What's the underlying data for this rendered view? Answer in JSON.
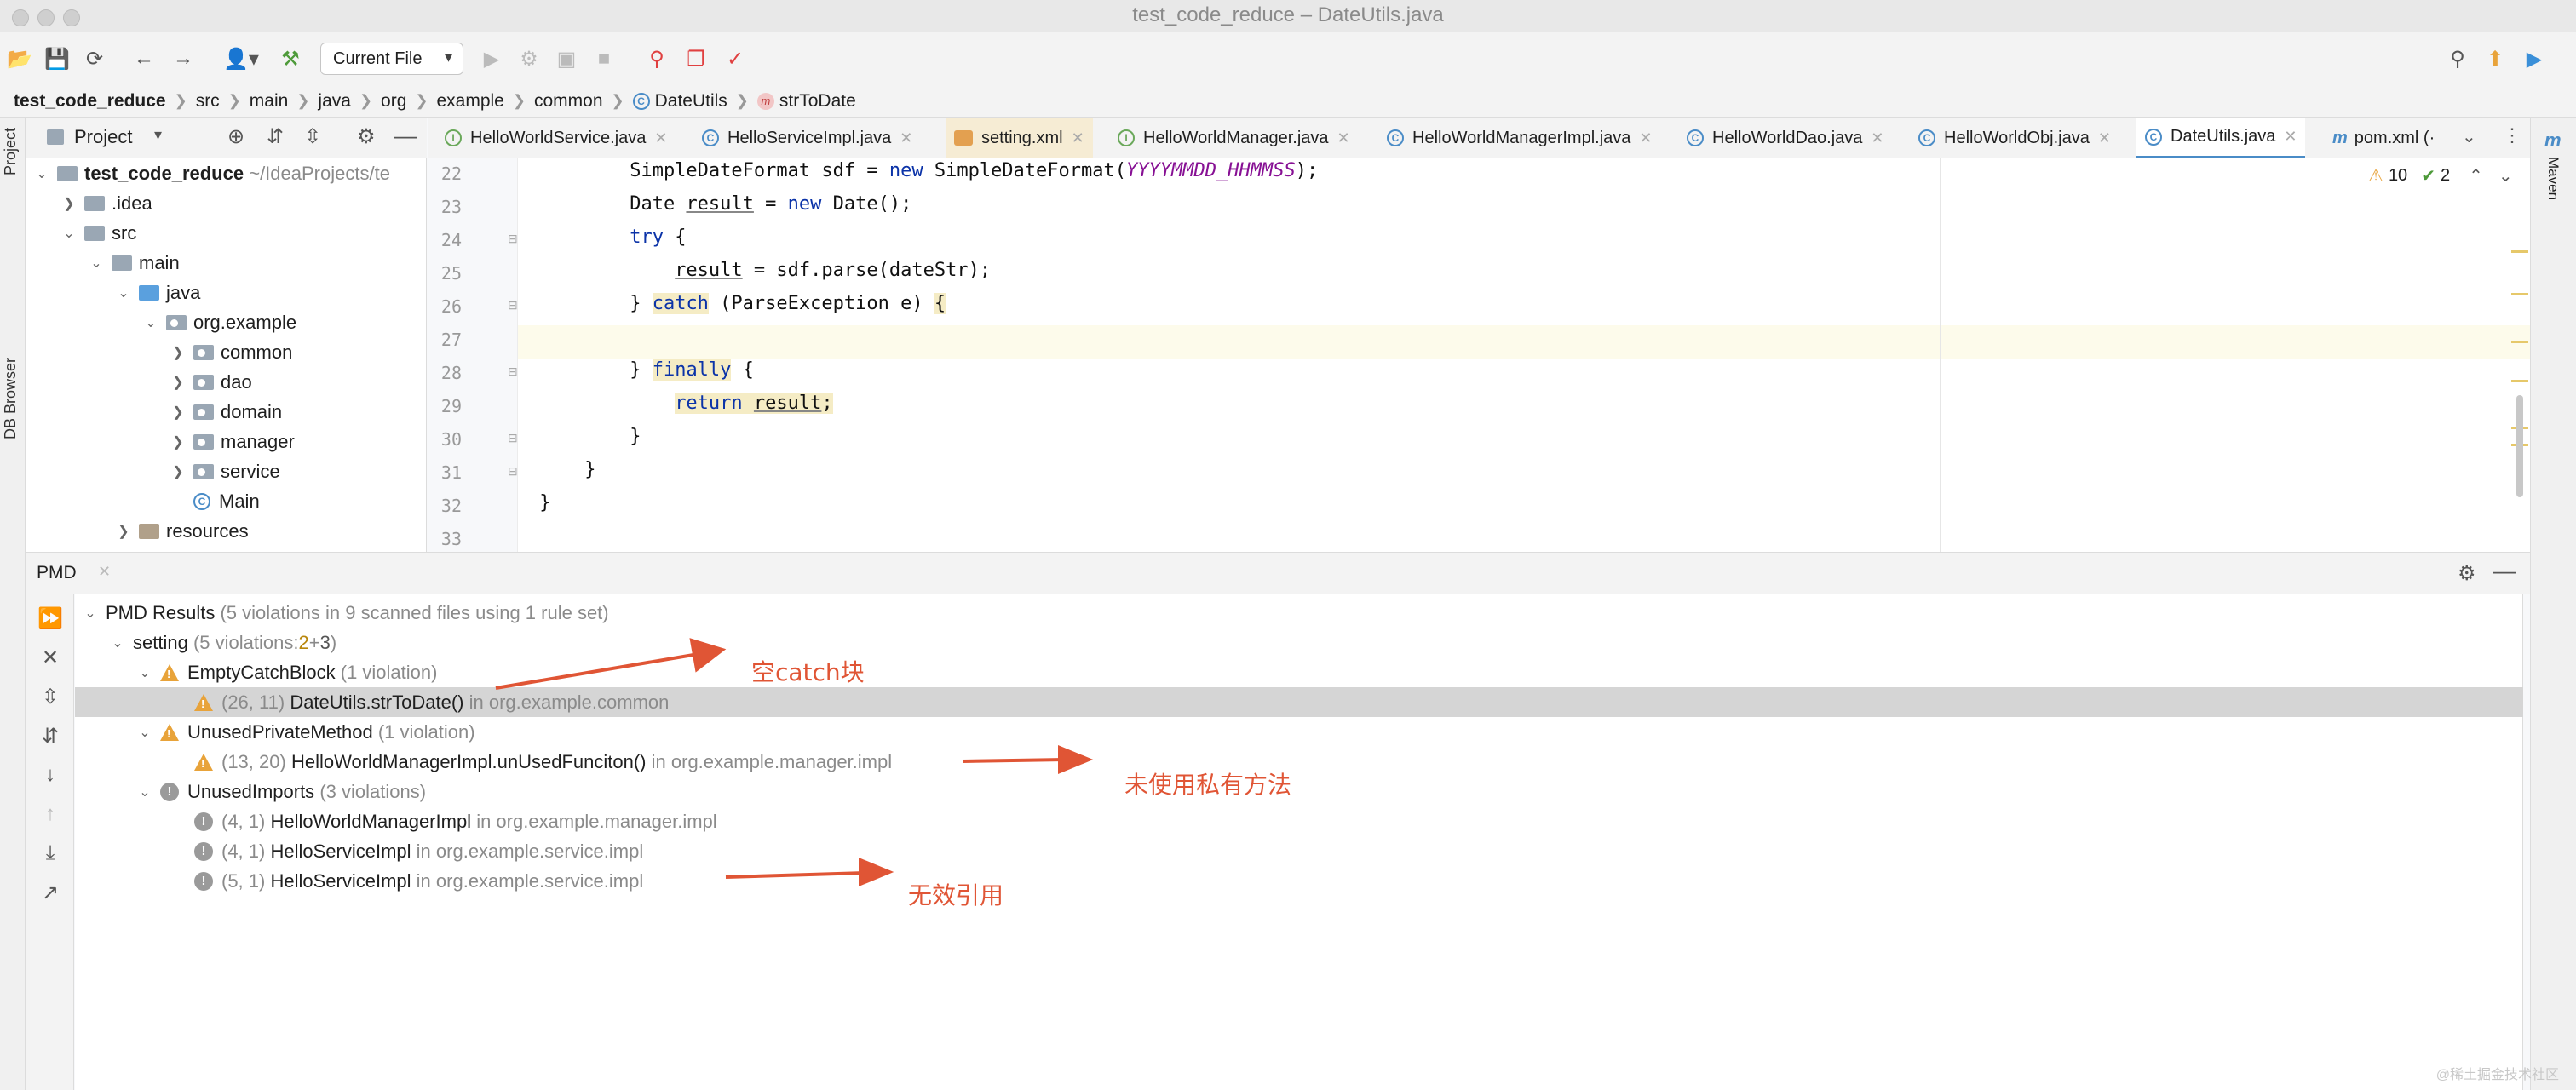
{
  "window": {
    "title": "test_code_reduce – DateUtils.java"
  },
  "toolbar": {
    "run_config": "Current File"
  },
  "breadcrumb": [
    "test_code_reduce",
    "src",
    "main",
    "java",
    "org",
    "example",
    "common",
    "DateUtils",
    "strToDate"
  ],
  "side_tabs": {
    "left": [
      "Project",
      "DB Browser"
    ],
    "right": [
      "Maven"
    ]
  },
  "project": {
    "header": "Project",
    "root_name": "test_code_reduce",
    "root_path": "~/IdeaProjects/te",
    "items": [
      ".idea",
      "src",
      "main",
      "java",
      "org.example",
      "common",
      "dao",
      "domain",
      "manager",
      "service",
      "Main",
      "resources"
    ]
  },
  "tabs": [
    "HelloWorldService.java",
    "HelloServiceImpl.java",
    "setting.xml",
    "HelloWorldManager.java",
    "HelloWorldManagerImpl.java",
    "HelloWorldDao.java",
    "HelloWorldObj.java",
    "DateUtils.java",
    "pom.xml (·"
  ],
  "inspection": {
    "warnings": "10",
    "ok": "2"
  },
  "editor": {
    "line_numbers": [
      "22",
      "23",
      "24",
      "25",
      "26",
      "27",
      "28",
      "29",
      "30",
      "31",
      "32",
      "33"
    ]
  },
  "pmd": {
    "tab": "PMD",
    "results_label": "PMD Results",
    "results_meta": "(5 violations in 9 scanned files using 1 rule set)",
    "ruleset": "setting",
    "ruleset_meta_a": "(5 violations: ",
    "ruleset_meta_b": "2",
    "ruleset_meta_c": " + ",
    "ruleset_meta_d": "3",
    "ruleset_meta_e": ")",
    "rules": [
      {
        "name": "EmptyCatchBlock",
        "meta": "(1 violation)",
        "items": [
          {
            "pos": "(26, 11)",
            "label": "DateUtils.strToDate()",
            "loc": "in org.example.common"
          }
        ]
      },
      {
        "name": "UnusedPrivateMethod",
        "meta": "(1 violation)",
        "items": [
          {
            "pos": "(13, 20)",
            "label": "HelloWorldManagerImpl.unUsedFunciton()",
            "loc": "in org.example.manager.impl"
          }
        ]
      },
      {
        "name": "UnusedImports",
        "meta": "(3 violations)",
        "items": [
          {
            "pos": "(4, 1)",
            "label": "HelloWorldManagerImpl",
            "loc": "in org.example.manager.impl"
          },
          {
            "pos": "(4, 1)",
            "label": "HelloServiceImpl",
            "loc": "in org.example.service.impl"
          },
          {
            "pos": "(5, 1)",
            "label": "HelloServiceImpl",
            "loc": "in org.example.service.impl"
          }
        ]
      }
    ]
  },
  "annotations": [
    "空catch块",
    "未使用私有方法",
    "无效引用"
  ],
  "watermark": "@稀土掘金技术社区",
  "colors": {
    "annotation": "#e05535",
    "selection": "#d5d5d5",
    "keyword": "#0b33a8",
    "constant": "#871094"
  }
}
